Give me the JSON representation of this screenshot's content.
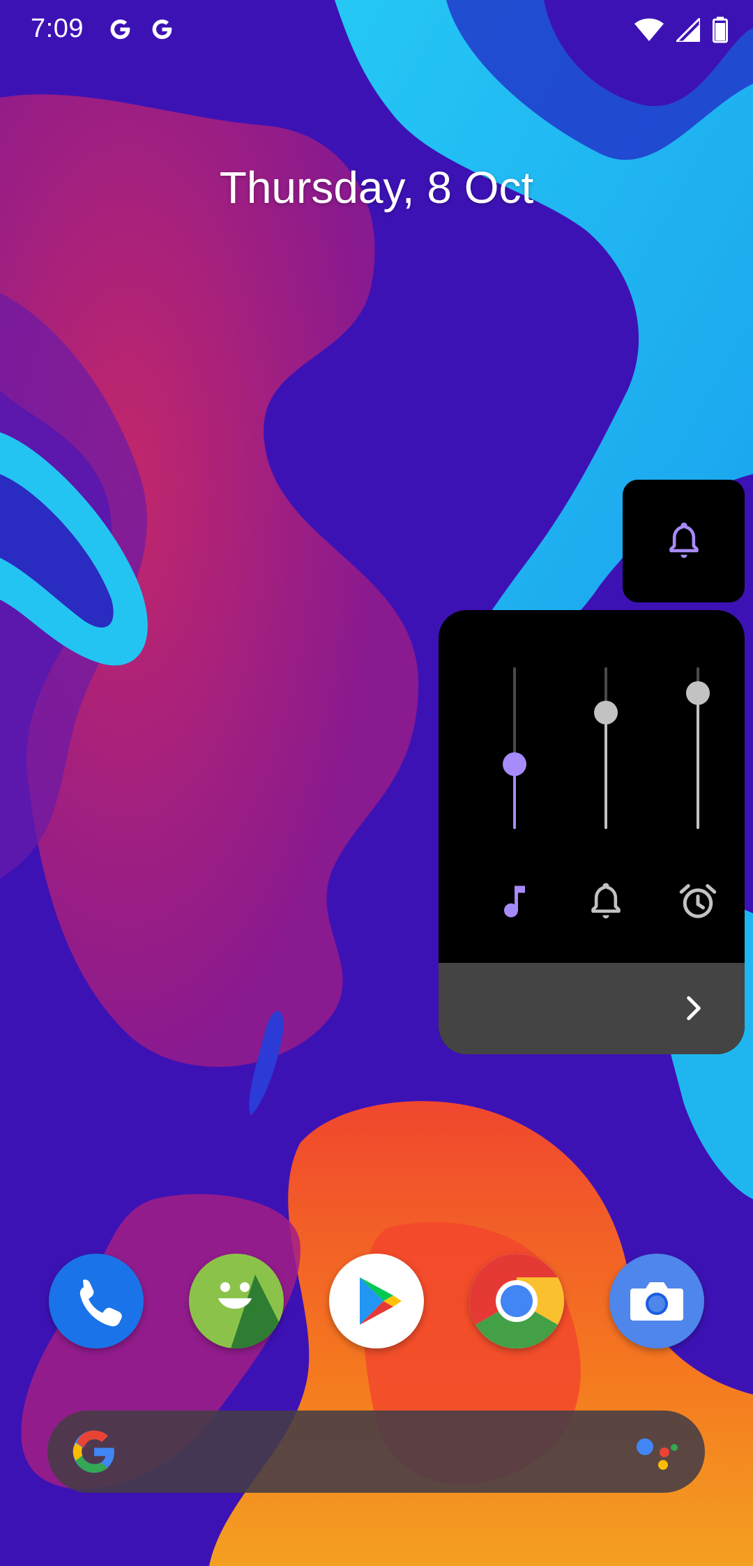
{
  "status_bar": {
    "time": "7:09",
    "notification_icons": [
      "google-g-icon",
      "google-g-icon"
    ],
    "system_icons": [
      "wifi-icon",
      "cell-signal-icon",
      "battery-icon"
    ]
  },
  "lockscreen": {
    "date": "Thursday, 8 Oct"
  },
  "volume_panel": {
    "ringer_mode_icon": "bell-icon",
    "accent_color": "#a78bfa",
    "inactive_color": "#c2c2c2",
    "streams": [
      {
        "name": "media",
        "icon": "music-note-icon",
        "level": 0.4,
        "active": true
      },
      {
        "name": "ring",
        "icon": "bell-icon",
        "level": 0.72,
        "active": false
      },
      {
        "name": "alarm",
        "icon": "alarm-clock-icon",
        "level": 0.84,
        "active": false
      }
    ],
    "footer_icon": "chevron-right-icon"
  },
  "dock": {
    "apps": [
      "phone-icon",
      "messaging-icon",
      "play-store-icon",
      "chrome-icon",
      "camera-icon"
    ]
  },
  "search_bar": {
    "left_icon": "google-logo-icon",
    "right_icon": "assistant-icon"
  }
}
